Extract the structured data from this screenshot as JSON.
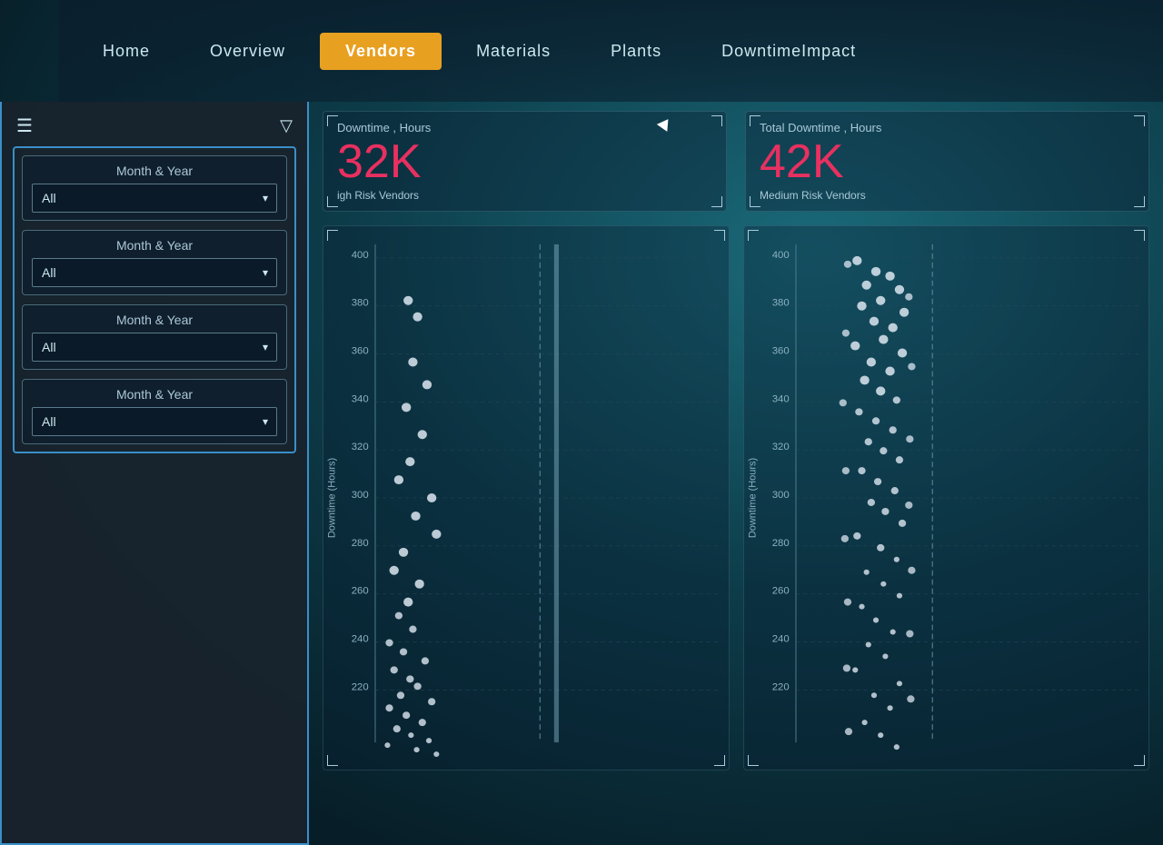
{
  "nav": {
    "items": [
      {
        "label": "Home",
        "active": false
      },
      {
        "label": "Overview",
        "active": false
      },
      {
        "label": "Vendors",
        "active": true
      },
      {
        "label": "Materials",
        "active": false
      },
      {
        "label": "Plants",
        "active": false
      },
      {
        "label": "DowntimeImpact",
        "active": false
      }
    ]
  },
  "sidebar": {
    "filters": [
      {
        "label": "Month & Year",
        "value": "All",
        "options": [
          "All"
        ]
      },
      {
        "label": "Month & Year",
        "value": "All",
        "options": [
          "All"
        ]
      },
      {
        "label": "Month & Year",
        "value": "All",
        "options": [
          "All"
        ]
      },
      {
        "label": "Month & Year",
        "value": "All",
        "options": [
          "All"
        ]
      }
    ]
  },
  "kpi": [
    {
      "title": "Downtime , Hours",
      "value": "32K",
      "subtitle": "igh Risk Vendors"
    },
    {
      "title": "Total Downtime , Hours",
      "value": "42K",
      "subtitle": "Medium Risk Vendors"
    }
  ],
  "charts": [
    {
      "title": "",
      "yLabel": "Downtime (Hours)",
      "yAxisValues": [
        "400",
        "380",
        "360",
        "340",
        "320",
        "300",
        "280",
        "260",
        "240",
        "220"
      ]
    },
    {
      "title": "",
      "yLabel": "Downtime (Hours)",
      "yAxisValues": [
        "400",
        "380",
        "360",
        "340",
        "320",
        "300",
        "280",
        "260",
        "240",
        "220"
      ]
    }
  ],
  "icons": {
    "hamburger": "☰",
    "filter": "▽",
    "chevron_down": "▾"
  }
}
